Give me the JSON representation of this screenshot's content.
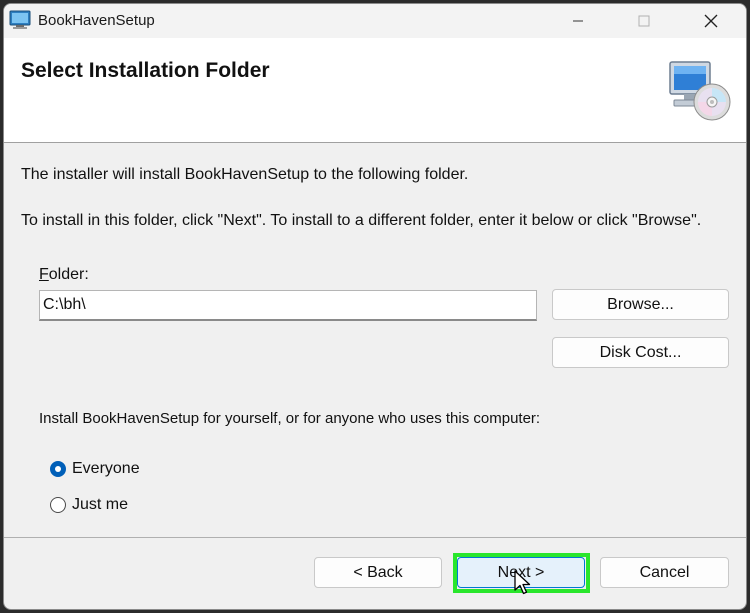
{
  "window": {
    "title": "BookHavenSetup",
    "controls": {
      "minimize_icon": "minimize-icon",
      "maximize_icon": "maximize-icon",
      "close_icon": "close-icon"
    }
  },
  "header": {
    "title": "Select Installation Folder",
    "icon": "computer-cd-icon"
  },
  "body": {
    "intro": "The installer will install BookHavenSetup to the following folder.",
    "instructions": "To install in this folder, click \"Next\". To install to a different folder, enter it below or click \"Browse\".",
    "folder_label_mnemonic": "F",
    "folder_label_rest": "older:",
    "folder_value": "C:\\bh\\",
    "browse_label": "Browse...",
    "disk_cost_label": "Disk Cost...",
    "install_for_label": "Install BookHavenSetup for yourself, or for anyone who uses this computer:",
    "options": [
      {
        "label": "Everyone",
        "selected": true
      },
      {
        "label": "Just me",
        "selected": false
      }
    ]
  },
  "footer": {
    "back_label": "< Back",
    "next_label": "Next >",
    "cancel_label": "Cancel"
  },
  "colors": {
    "accent": "#005fb8",
    "highlight": "#29e62c",
    "window_bg": "#f0f0f0",
    "header_bg": "#ffffff"
  }
}
